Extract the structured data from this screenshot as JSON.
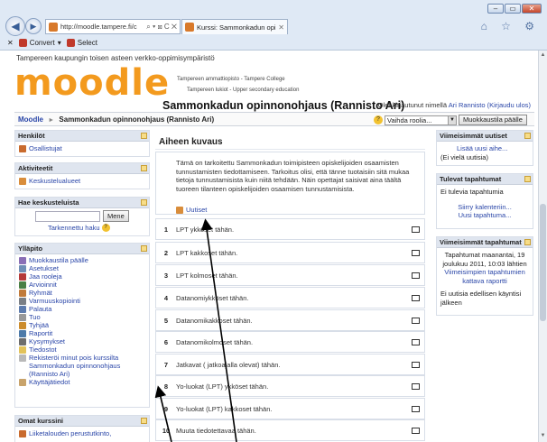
{
  "browser": {
    "window_buttons": [
      "–",
      "▭",
      "✕"
    ],
    "url": "http://moodle.tampere.fi/c",
    "address_tools": "⌕ ▾ ⊠ C ✕",
    "tab_title": "Kurssi: Sammonkadun opi...",
    "tab_close": "✕",
    "right_icons": "⌂ ☆ ⚙",
    "commands": {
      "close": "✕",
      "convert": "Convert",
      "select": "Select"
    }
  },
  "site": {
    "top_line": "Tampereen kaupungin toisen asteen verkko-oppimisympäristö",
    "logo": "moodle",
    "sub1": "Tampereen ammattiopisto - Tampere College",
    "sub2": "Tampereen lukiot - Upper secondary education",
    "course_title": "Sammonkadun opinnonohjaus (Rannisto Ari)",
    "login_prefix": "Olet kirjautunut nimellä ",
    "login_user": "Ari Rannisto",
    "login_logout": "(Kirjaudu ulos)"
  },
  "nav": {
    "home": "Moodle",
    "sep": "►",
    "current": "Sammonkadun opinnonohjaus (Rannisto Ari)",
    "role_select": "Vaihda roolia...",
    "edit_button": "Muokkaustila päälle"
  },
  "left": {
    "people": {
      "title": "Henkilöt",
      "items": [
        "Osallistujat"
      ]
    },
    "activities": {
      "title": "Aktiviteetit",
      "items": [
        "Keskustelualueet"
      ]
    },
    "search": {
      "title": "Hae keskusteluista",
      "button": "Mene",
      "advanced": "Tarkennettu haku"
    },
    "admin": {
      "title": "Ylläpito",
      "items": [
        "Muokkaustila päälle",
        "Asetukset",
        "Jaa rooleja",
        "Arvioinnit",
        "Ryhmät",
        "Varmuuskopiointi",
        "Palauta",
        "Tuo",
        "Tyhjää",
        "Raportit",
        "Kysymykset",
        "Tiedostot",
        "Rekisteröi minut pois kurssilta Sammonkadun opinnonohjaus (Rannisto Ari)",
        "Käyttäjätiedot"
      ]
    },
    "mycourses": {
      "title": "Omat kurssini",
      "items": [
        "Liiketalouden perustutkinto,"
      ]
    }
  },
  "main": {
    "header": "Aiheen kuvaus",
    "intro": "Tämä on tarkoitettu Sammonkadun toimipisteen opiskelijoiden osaamisten tunnustamisten tiedottamiseen. Tarkoitus olisi, että tänne tuotaisiin sitä mukaa tietoja tunnustamisista kuin niitä tehdään. Näin opettajat saisivat aina täältä tuoreen tilanteen opiskelijoiden osaamisen tunnustamisista.",
    "news_link": "Uutiset",
    "topics": [
      {
        "num": "1",
        "label": "LPT ykköset tähän."
      },
      {
        "num": "2",
        "label": "LPT kakkoset tähän."
      },
      {
        "num": "3",
        "label": "LPT kolmoset tähän."
      },
      {
        "num": "4",
        "label": "Datanomiykköset tähän."
      },
      {
        "num": "5",
        "label": "Datanomikakkoset tähän."
      },
      {
        "num": "6",
        "label": "Datanomikolmoset tähän."
      },
      {
        "num": "7",
        "label": "Jatkavat ( jatkoajalla olevat) tähän."
      },
      {
        "num": "8",
        "label": "Yo-luokat (LPT) ykköset tähän."
      },
      {
        "num": "9",
        "label": "Yo-luokat (LPT) kakkoset tähän."
      },
      {
        "num": "10",
        "label": "Muuta tiedotettavaa tähän."
      }
    ]
  },
  "right": {
    "news": {
      "title": "Viimeisimmät uutiset",
      "add": "Lisää uusi aihe...",
      "none": "(Ei vielä uutisia)"
    },
    "upcoming": {
      "title": "Tulevat tapahtumat",
      "none": "Ei tulevia tapahtumia",
      "calendar": "Siirry kalenteriin...",
      "new_event": "Uusi tapahtuma..."
    },
    "recent": {
      "title": "Viimeisimmät tapahtumat",
      "date": "Tapahtumat maanantai, 19 joulukuu 2011, 10:03 lähtien",
      "full_report": "Viimeisimpien tapahtumien kattava raportti",
      "none": "Ei uutisia edellisen käyntisi jälkeen"
    }
  }
}
